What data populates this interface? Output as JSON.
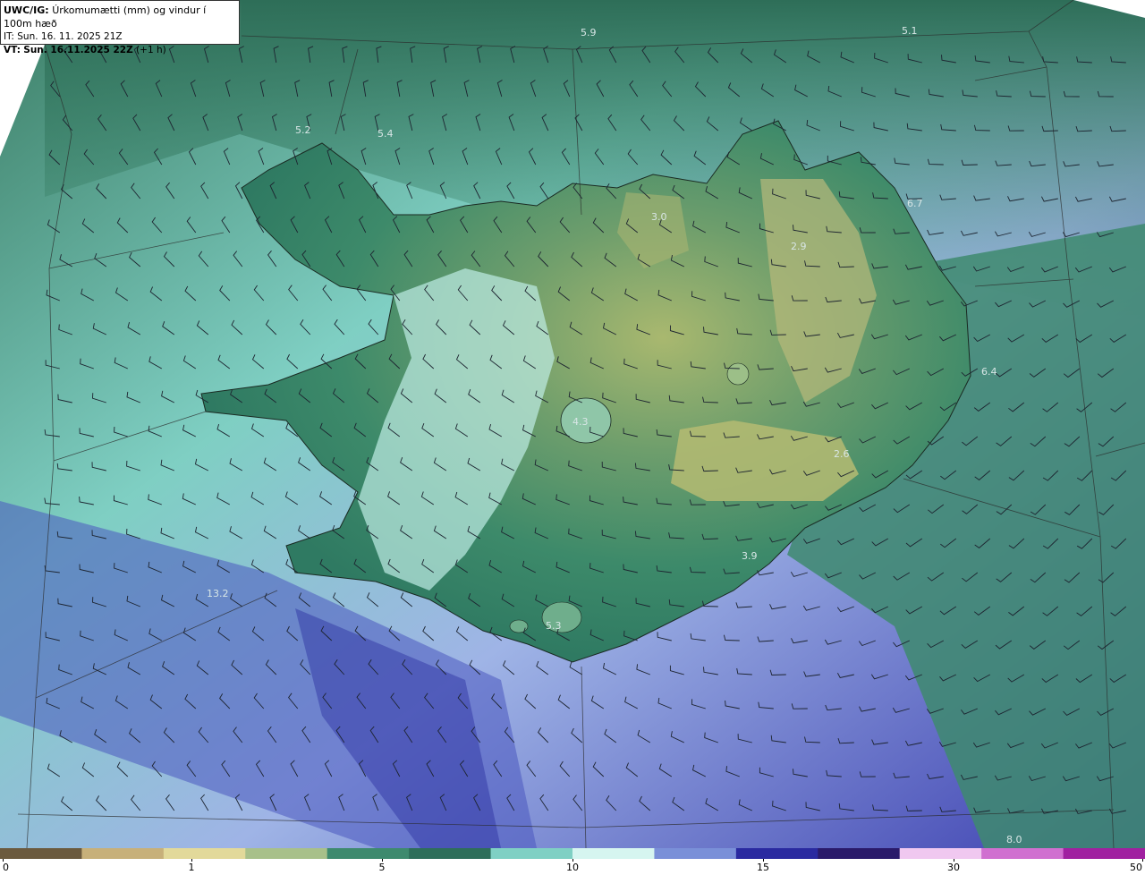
{
  "header": {
    "code": "UWC/IG:",
    "description": "Úrkomumætti (mm) og vindur í 100m hæð",
    "init_label": "IT:",
    "init_time": "Sun. 16. 11. 2025 21Z",
    "valid_label": "VT:",
    "valid_time": "Sun. 16.11.2025 22Z",
    "lead": "(+1 h)"
  },
  "legend": {
    "ticks": [
      {
        "label": "0",
        "value": 0
      },
      {
        "label": "1",
        "value": 1
      },
      {
        "label": "5",
        "value": 5
      },
      {
        "label": "10",
        "value": 10
      },
      {
        "label": "15",
        "value": 15
      },
      {
        "label": "30",
        "value": 30
      },
      {
        "label": "50",
        "value": 50
      }
    ],
    "colors": [
      "#6b5a3e",
      "#c7b07a",
      "#e2d99a",
      "#a8c08a",
      "#3e8a6e",
      "#2e6e5a",
      "#7fd0c4",
      "#d6f5f0",
      "#7a90d8",
      "#2a2aa0",
      "#2a1a6a",
      "#f0c8f0",
      "#d070d0",
      "#a020a0"
    ]
  },
  "value_labels": [
    {
      "text": "5.9"
    },
    {
      "text": "5.1"
    },
    {
      "text": "5.2"
    },
    {
      "text": "5.4"
    },
    {
      "text": "3.0"
    },
    {
      "text": "2.9"
    },
    {
      "text": "6.7"
    },
    {
      "text": "6.4"
    },
    {
      "text": "4.3"
    },
    {
      "text": "2.6"
    },
    {
      "text": "3.9"
    },
    {
      "text": "5.3"
    },
    {
      "text": "13.2"
    },
    {
      "text": "8.0"
    }
  ]
}
